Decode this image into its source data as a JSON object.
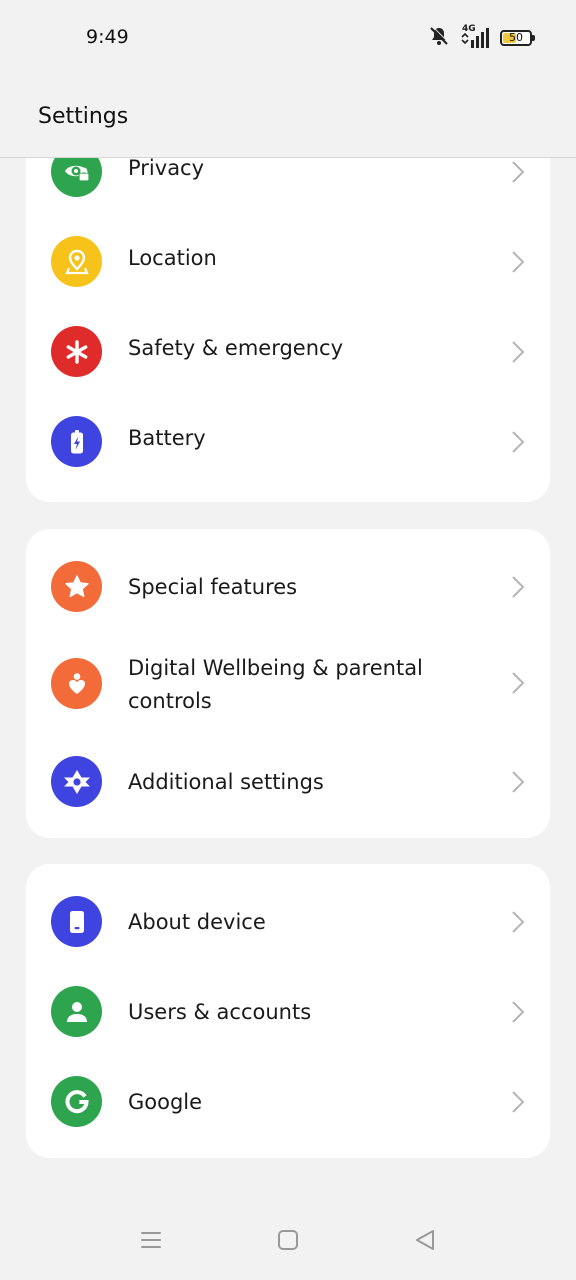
{
  "status_bar": {
    "time": "9:49",
    "network": "4G",
    "battery_level": "50",
    "icons": [
      "mute-bell-icon",
      "signal-icon",
      "battery-icon"
    ]
  },
  "header": {
    "title": "Settings"
  },
  "groups": [
    {
      "items": [
        {
          "label": "Privacy",
          "icon": "privacy-eye-icon",
          "color": "#2ea44f"
        },
        {
          "label": "Location",
          "icon": "location-pin-icon",
          "color": "#f7c21a"
        },
        {
          "label": "Safety & emergency",
          "icon": "asterisk-icon",
          "color": "#e02b2b"
        },
        {
          "label": "Battery",
          "icon": "battery-bolt-icon",
          "color": "#3f43df"
        }
      ]
    },
    {
      "items": [
        {
          "label": "Special features",
          "icon": "star-icon",
          "color": "#f26b38"
        },
        {
          "label": "Digital Wellbeing & parental controls",
          "icon": "heart-person-icon",
          "color": "#f26b38"
        },
        {
          "label": "Additional settings",
          "icon": "star-of-david-gear-icon",
          "color": "#3f43df"
        }
      ]
    },
    {
      "items": [
        {
          "label": "About device",
          "icon": "phone-device-icon",
          "color": "#3f43df"
        },
        {
          "label": "Users & accounts",
          "icon": "user-icon",
          "color": "#2ea44f"
        },
        {
          "label": "Google",
          "icon": "google-g-icon",
          "color": "#2ea44f"
        }
      ]
    }
  ],
  "nav_bar": {
    "icons": [
      "menu-icon",
      "home-square-icon",
      "back-triangle-icon"
    ]
  }
}
